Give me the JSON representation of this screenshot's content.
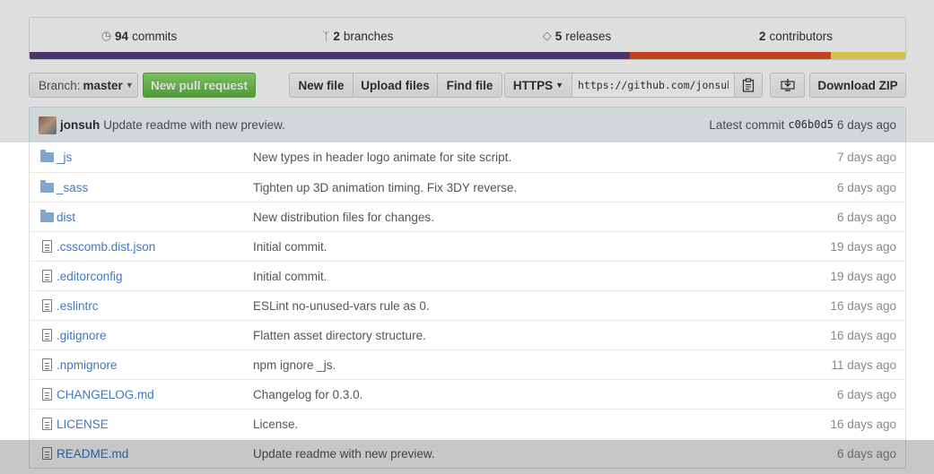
{
  "summary": {
    "commits": {
      "count": "94",
      "label": "commits"
    },
    "branches": {
      "count": "2",
      "label": "branches"
    },
    "releases": {
      "count": "5",
      "label": "releases"
    },
    "contributors": {
      "count": "2",
      "label": "contributors"
    },
    "languages": [
      {
        "color": "#563d7c",
        "share": 0.685
      },
      {
        "color": "#e34c26",
        "share": 0.23
      },
      {
        "color": "#f1e05a",
        "share": 0.085
      }
    ]
  },
  "toolbar": {
    "branch_prefix": "Branch:",
    "branch_name": "master",
    "new_pr": "New pull request",
    "new_file": "New file",
    "upload_files": "Upload files",
    "find_file": "Find file",
    "https": "HTTPS",
    "clone_url": "https://github.com/jonsuh",
    "download_zip": "Download ZIP"
  },
  "commit": {
    "author": "jonsuh",
    "message": "Update readme with new preview.",
    "latest_label": "Latest commit",
    "sha": "c06b0d5",
    "age": "6 days ago"
  },
  "files": [
    {
      "type": "dir",
      "name": "_js",
      "message": "New types in header logo animate for site script.",
      "age": "7 days ago"
    },
    {
      "type": "dir",
      "name": "_sass",
      "message": "Tighten up 3D animation timing. Fix 3DY reverse.",
      "age": "6 days ago"
    },
    {
      "type": "dir",
      "name": "dist",
      "message": "New distribution files for changes.",
      "age": "6 days ago"
    },
    {
      "type": "file",
      "name": ".csscomb.dist.json",
      "message": "Initial commit.",
      "age": "19 days ago"
    },
    {
      "type": "file",
      "name": ".editorconfig",
      "message": "Initial commit.",
      "age": "19 days ago"
    },
    {
      "type": "file",
      "name": ".eslintrc",
      "message": "ESLint no-unused-vars rule as 0.",
      "age": "16 days ago"
    },
    {
      "type": "file",
      "name": ".gitignore",
      "message": "Flatten asset directory structure.",
      "age": "16 days ago"
    },
    {
      "type": "file",
      "name": ".npmignore",
      "message": "npm ignore _js.",
      "age": "11 days ago"
    },
    {
      "type": "file",
      "name": "CHANGELOG.md",
      "message": "Changelog for 0.3.0.",
      "age": "6 days ago"
    },
    {
      "type": "file",
      "name": "LICENSE",
      "message": "License.",
      "age": "16 days ago"
    },
    {
      "type": "file",
      "name": "README.md",
      "message": "Update readme with new preview.",
      "age": "6 days ago"
    }
  ]
}
